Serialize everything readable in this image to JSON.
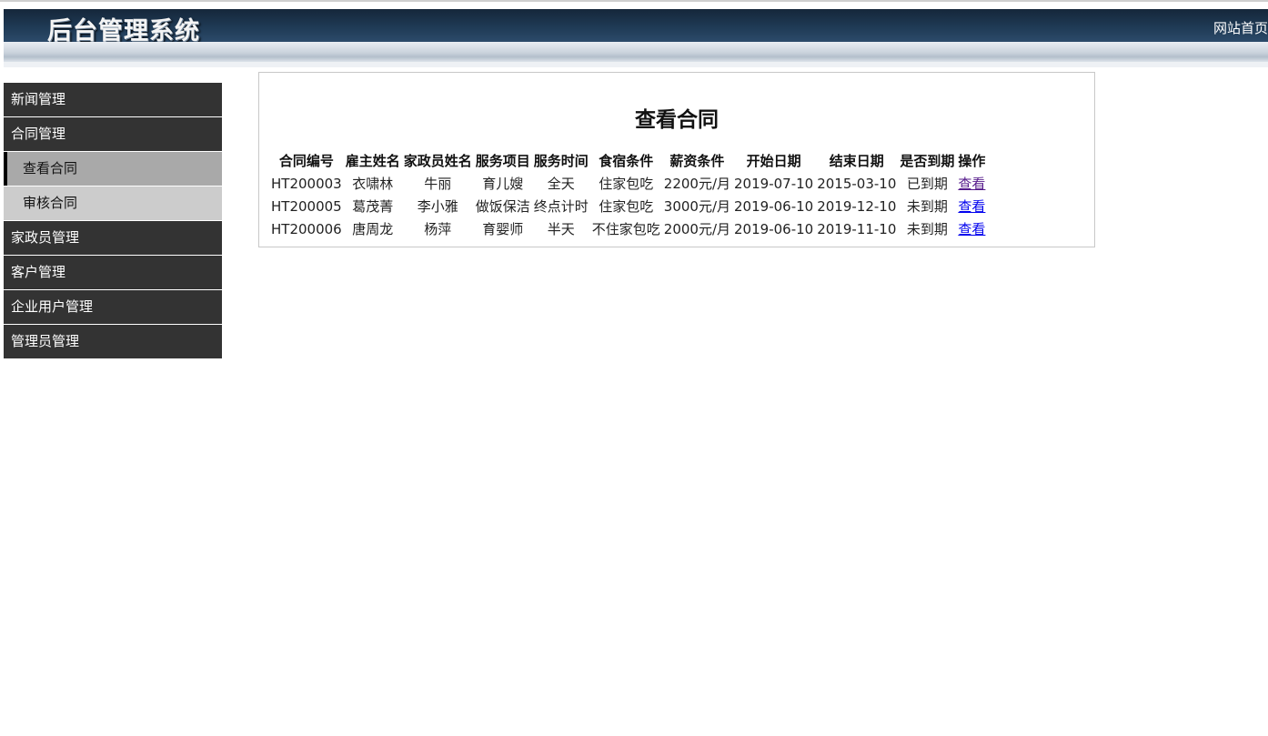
{
  "header": {
    "title": "后台管理系统",
    "home_link": "网站首页"
  },
  "sidebar": {
    "items": [
      {
        "label": "新闻管理"
      },
      {
        "label": "合同管理"
      },
      {
        "label": "查看合同"
      },
      {
        "label": "审核合同"
      },
      {
        "label": "家政员管理"
      },
      {
        "label": "客户管理"
      },
      {
        "label": "企业用户管理"
      },
      {
        "label": "管理员管理"
      }
    ]
  },
  "main": {
    "title": "查看合同",
    "columns": [
      "合同编号",
      "雇主姓名",
      "家政员姓名",
      "服务项目",
      "服务时间",
      "食宿条件",
      "薪资条件",
      "开始日期",
      "结束日期",
      "是否到期",
      "操作"
    ],
    "rows": [
      [
        "HT200003",
        "衣啸林",
        "牛丽",
        "育儿嫂",
        "全天",
        "住家包吃",
        "2200元/月",
        "2019-07-10",
        "2015-03-10",
        "已到期",
        "查看"
      ],
      [
        "HT200005",
        "葛茂菁",
        "李小雅",
        "做饭保洁",
        "终点计时",
        "住家包吃",
        "3000元/月",
        "2019-06-10",
        "2019-12-10",
        "未到期",
        "查看"
      ],
      [
        "HT200006",
        "唐周龙",
        "杨萍",
        "育婴师",
        "半天",
        "不住家包吃",
        "2000元/月",
        "2019-06-10",
        "2019-11-10",
        "未到期",
        "查看"
      ]
    ]
  },
  "colors": {
    "header_bg": "#1f3a55",
    "menu_bg": "#333333",
    "submenu_bg": "#cccccc",
    "submenu_active_bg": "#a9a9a9",
    "link": "#0000ee",
    "link_visited": "#551a8b"
  }
}
